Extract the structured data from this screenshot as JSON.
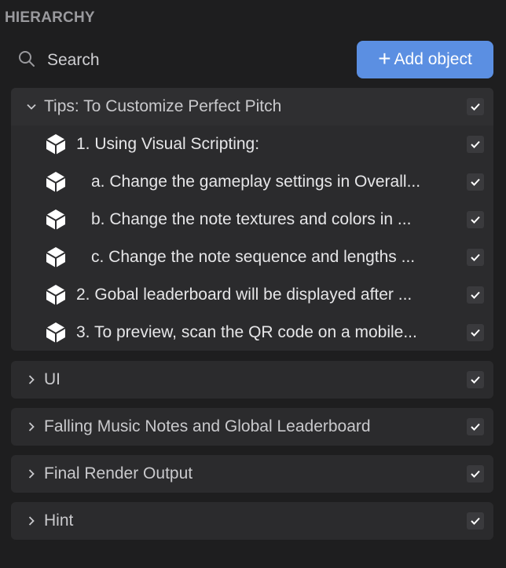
{
  "panel": {
    "title": "HIERARCHY"
  },
  "search": {
    "placeholder": "Search",
    "icon": "search-icon"
  },
  "add_button": {
    "label": "Add object",
    "icon": "plus-icon",
    "color": "#5b8fe2"
  },
  "groups": [
    {
      "label": "Tips: To Customize Perfect Pitch",
      "expanded": true,
      "checked": true,
      "items": [
        {
          "label": "1. Using Visual Scripting:",
          "checked": true,
          "indented": false
        },
        {
          "label": "a. Change the gameplay settings in Overall...",
          "checked": true,
          "indented": true
        },
        {
          "label": "b. Change the note textures and colors in ...",
          "checked": true,
          "indented": true
        },
        {
          "label": "c. Change the note sequence and lengths ...",
          "checked": true,
          "indented": true
        },
        {
          "label": "2. Gobal leaderboard will be displayed after ...",
          "checked": true,
          "indented": false
        },
        {
          "label": "3. To preview, scan the QR code on a mobile...",
          "checked": true,
          "indented": false
        }
      ]
    },
    {
      "label": "UI",
      "expanded": false,
      "checked": true
    },
    {
      "label": "Falling Music Notes and Global Leaderboard",
      "expanded": false,
      "checked": true
    },
    {
      "label": "Final Render Output",
      "expanded": false,
      "checked": true
    },
    {
      "label": "Hint",
      "expanded": false,
      "checked": true
    }
  ]
}
